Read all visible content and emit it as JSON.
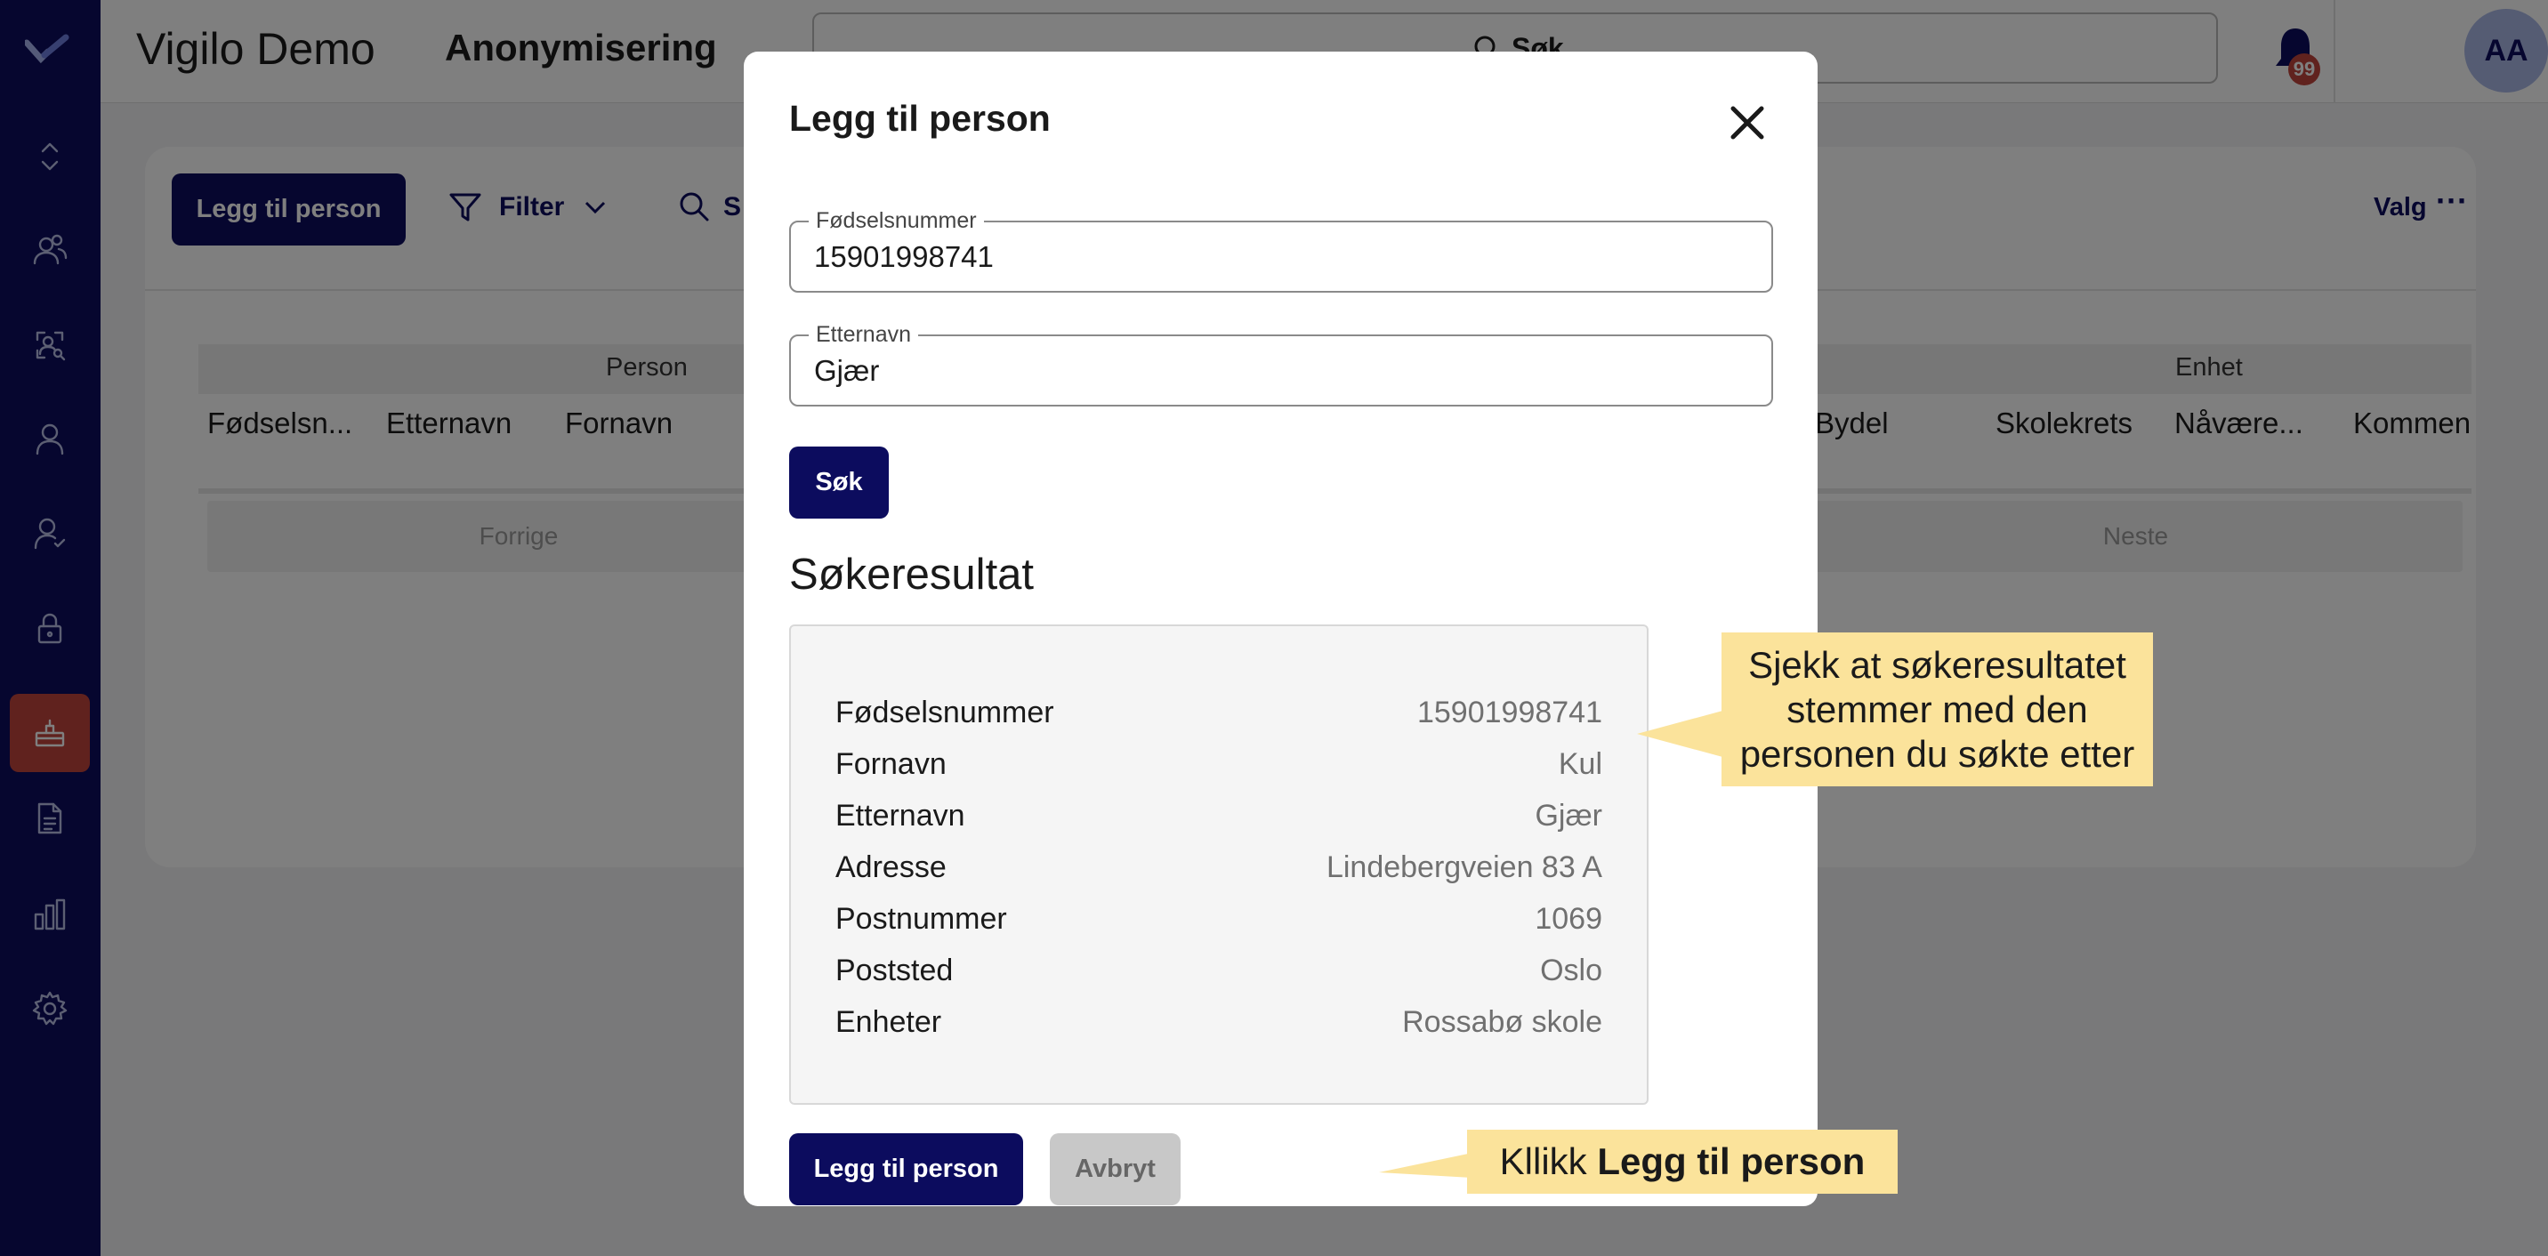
{
  "app": {
    "title": "Vigilo Demo",
    "page_title": "Anonymisering",
    "search_label": "Søk",
    "notification_count": "99",
    "avatar_initials": "AA"
  },
  "sidebar": {
    "items": [
      {
        "icon": "collapse-icon"
      },
      {
        "icon": "users-group-icon"
      },
      {
        "icon": "user-search-icon"
      },
      {
        "icon": "user-icon"
      },
      {
        "icon": "user-check-icon"
      },
      {
        "icon": "lock-icon"
      },
      {
        "icon": "anonymize-icon",
        "active": true
      },
      {
        "icon": "document-icon"
      },
      {
        "icon": "bar-chart-icon"
      },
      {
        "icon": "gear-icon"
      }
    ]
  },
  "toolbar": {
    "add_label": "Legg til person",
    "filter_label": "Filter",
    "search_label": "S",
    "valg_label": "Valg",
    "more_label": "···"
  },
  "table": {
    "groups": [
      "Person",
      "Enhet"
    ],
    "columns": [
      "Fødselsn...",
      "Etternavn",
      "Fornavn",
      "Bydel",
      "Skolekrets",
      "Nåvære...",
      "Kommen"
    ],
    "prev_label": "Forrige",
    "next_label": "Neste"
  },
  "modal": {
    "title": "Legg til person",
    "ssn_label": "Fødselsnummer",
    "ssn_value": "15901998741",
    "lastname_label": "Etternavn",
    "lastname_value": "Gjær",
    "search_button": "Søk",
    "results_heading": "Søkeresultat",
    "results": [
      {
        "key": "Fødselsnummer",
        "value": "15901998741"
      },
      {
        "key": "Fornavn",
        "value": "Kul"
      },
      {
        "key": "Etternavn",
        "value": "Gjær"
      },
      {
        "key": "Adresse",
        "value": "Lindebergveien 83 A"
      },
      {
        "key": "Postnummer",
        "value": "1069"
      },
      {
        "key": "Poststed",
        "value": "Oslo"
      },
      {
        "key": "Enheter",
        "value": "Rossabø skole"
      }
    ],
    "add_button": "Legg til person",
    "cancel_button": "Avbryt"
  },
  "callouts": {
    "check": "Sjekk at søkeresultatet stemmer med den personen du søkte etter",
    "click_prefix": "Kllikk ",
    "click_bold": "Legg til person"
  },
  "colors": {
    "sidebar": "#0c0c5e",
    "primary": "#0c0c5e",
    "active": "#c0443c",
    "callout": "#fbe39b"
  }
}
